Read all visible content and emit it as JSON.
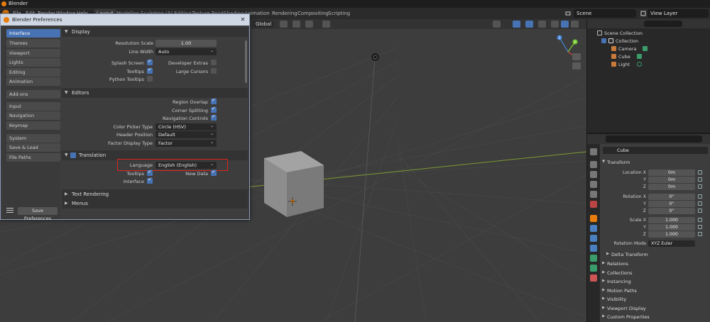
{
  "app": {
    "title": "Blender"
  },
  "menubar": {
    "items": [
      "File",
      "Edit",
      "Render",
      "Window",
      "Help"
    ],
    "workspaces": [
      "Layout",
      "Modeling",
      "Sculpting",
      "UV Editing",
      "Texture Paint",
      "Shading",
      "Animation",
      "Rendering",
      "Compositing",
      "Scripting"
    ],
    "active_workspace": "Layout",
    "scene": "Scene",
    "view_layer": "View Layer"
  },
  "viewport": {
    "transform_orientation": "Global",
    "gizmo_axes": [
      "X",
      "Y",
      "Z"
    ]
  },
  "preferences": {
    "title": "Blender Preferences",
    "sidebar_groups": [
      [
        "Interface",
        "Themes",
        "Viewport",
        "Lights",
        "Editing",
        "Animation"
      ],
      [
        "Add-ons"
      ],
      [
        "Input",
        "Navigation",
        "Keymap"
      ],
      [
        "System",
        "Save & Load",
        "File Paths"
      ]
    ],
    "active_item": "Interface",
    "save_button": "Save Preferences",
    "sections": {
      "display": {
        "title": "Display",
        "resolution_scale_label": "Resolution Scale",
        "resolution_scale_value": "1.00",
        "line_width_label": "Line Width",
        "line_width_value": "Auto",
        "splash_screen_label": "Splash Screen",
        "tooltips_label": "Tooltips",
        "python_tooltips_label": "Python Tooltips",
        "developer_extras_label": "Developer Extras",
        "large_cursors_label": "Large Cursors"
      },
      "editors": {
        "title": "Editors",
        "region_overlap_label": "Region Overlap",
        "corner_splitting_label": "Corner Splitting",
        "navigation_controls_label": "Navigation Controls",
        "color_picker_label": "Color Picker Type",
        "color_picker_value": "Circle (HSV)",
        "header_position_label": "Header Position",
        "header_position_value": "Default",
        "factor_display_label": "Factor Display Type",
        "factor_display_value": "Factor"
      },
      "translation": {
        "title": "Translation",
        "language_label": "Language",
        "language_value": "English (English)",
        "tooltips_label": "Tooltips",
        "interface_label": "Interface",
        "new_data_label": "New Data"
      },
      "text_rendering": {
        "title": "Text Rendering"
      },
      "menus": {
        "title": "Menus"
      }
    }
  },
  "outliner": {
    "scene_collection": "Scene Collection",
    "collection": "Collection",
    "objects": [
      "Camera",
      "Cube",
      "Light"
    ]
  },
  "properties": {
    "object_name": "Cube",
    "transform_title": "Transform",
    "location_x_label": "Location X",
    "location_x": "0m",
    "location_y_label": "Y",
    "location_y": "0m",
    "location_z_label": "Z",
    "location_z": "0m",
    "rotation_x_label": "Rotation X",
    "rotation_x": "0°",
    "rotation_y_label": "Y",
    "rotation_y": "0°",
    "rotation_z_label": "Z",
    "rotation_z": "0°",
    "scale_x_label": "Scale X",
    "scale_x": "1.000",
    "scale_y_label": "Y",
    "scale_y": "1.000",
    "scale_z_label": "Z",
    "scale_z": "1.000",
    "rotation_mode_label": "Rotation Mode",
    "rotation_mode": "XYZ Euler",
    "delta_transform": "Delta Transform",
    "collapsed_sections": [
      "Relations",
      "Collections",
      "Instancing",
      "Motion Paths",
      "Visibility",
      "Viewport Display",
      "Custom Properties"
    ]
  },
  "colors": {
    "accent": "#4772b3",
    "highlight": "#e0251c",
    "brand": "#e87d0d"
  }
}
